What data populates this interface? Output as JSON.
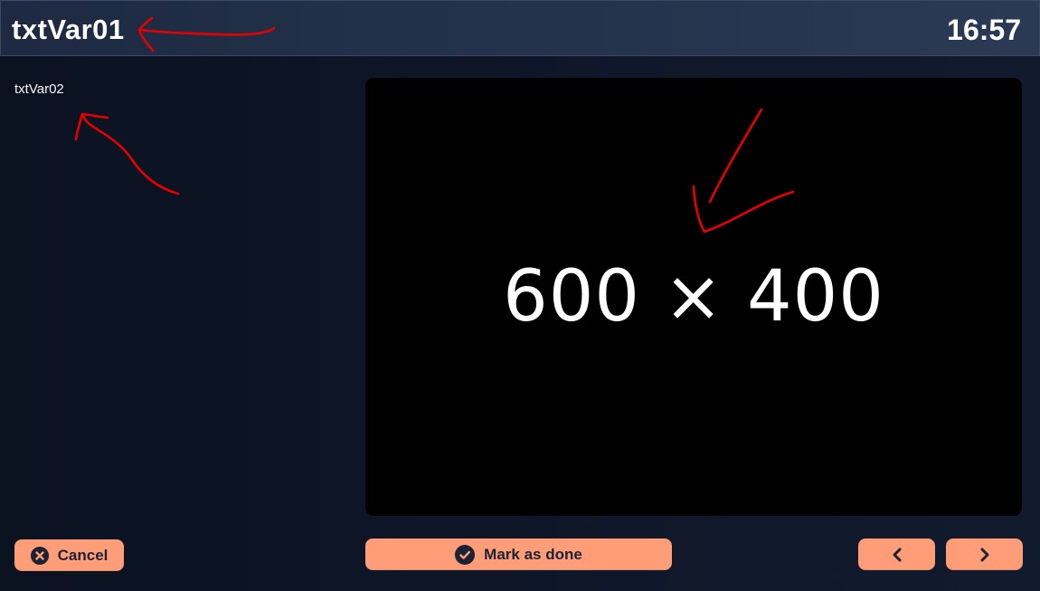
{
  "header": {
    "title": "txtVar01",
    "clock": "16:57"
  },
  "content": {
    "subtitle": "txtVar02",
    "media_placeholder": "600 × 400"
  },
  "actions": {
    "cancel_label": "Cancel",
    "mark_done_label": "Mark as done",
    "prev_icon": "chevron-left-icon",
    "next_icon": "chevron-right-icon"
  },
  "colors": {
    "button_bg": "#ff9d78",
    "button_text": "#1b2233",
    "annotation": "#e60000",
    "header_bg": "#26354f",
    "page_bg": "#0e1628",
    "media_bg": "#000000"
  }
}
